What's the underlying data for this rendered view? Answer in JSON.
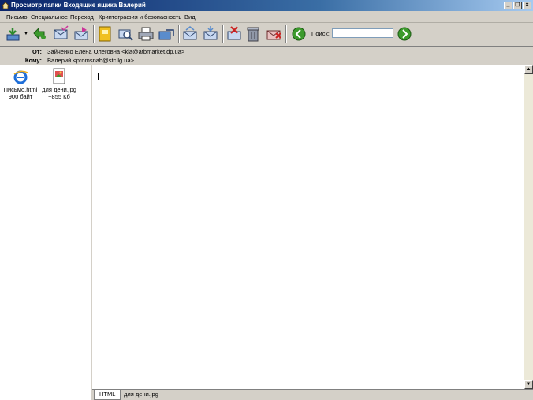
{
  "window": {
    "title": "Просмотр папки Входящие ящика Валерий",
    "buttons": {
      "minimize": "_",
      "restore": "❐",
      "close": "×"
    }
  },
  "menu": {
    "items": [
      "Письмо",
      "Специальное",
      "Переход",
      "Криптография и безопасность",
      "Вид"
    ]
  },
  "toolbar": {
    "search_label": "Поиск:",
    "search_value": ""
  },
  "headers": {
    "from_label": "От:",
    "from_value": "Зайченко Елена Олеговна <kia@atbmarket.dp.ua>",
    "to_label": "Кому:",
    "to_value": "Валерий <promsnab@stc.lg.ua>"
  },
  "attachments": [
    {
      "name": "Письмо.html",
      "size": "900 байт",
      "icon": "ie-html-icon"
    },
    {
      "name": "для дени.jpg",
      "size": "~855 Кб",
      "icon": "jpg-image-icon"
    }
  ],
  "tabs": [
    "HTML",
    "для дени.jpg"
  ],
  "colors": {
    "titlebar": "#0a246a",
    "accent_green": "#3c9a2c",
    "chrome": "#d4d0c8"
  }
}
